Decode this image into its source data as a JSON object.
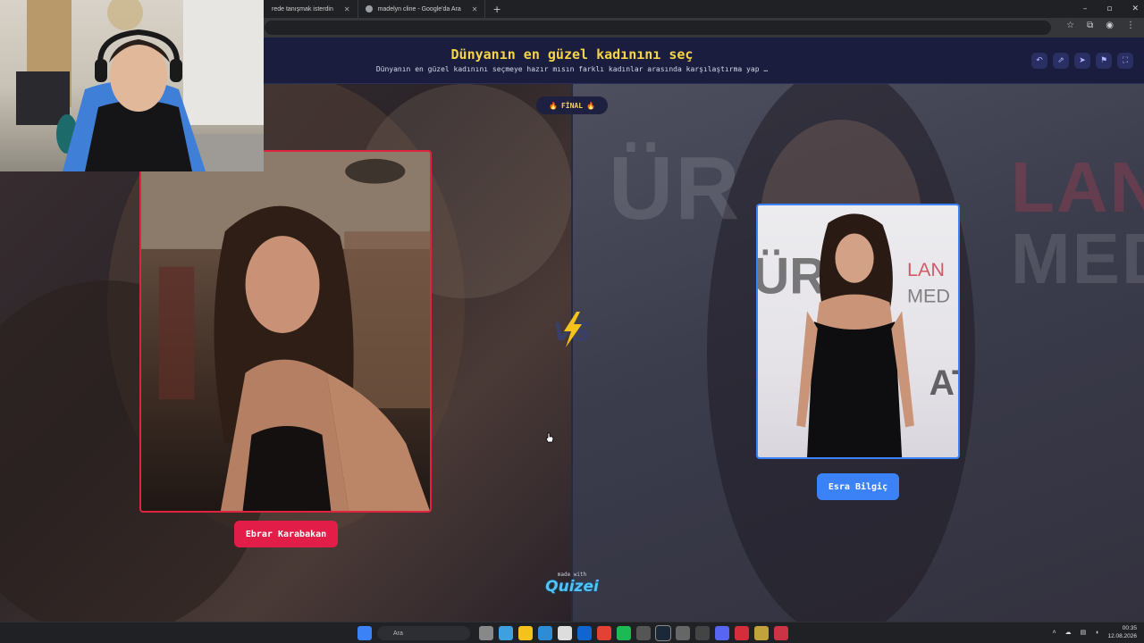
{
  "browser": {
    "tabs": [
      {
        "label": "rede tanışmak isterdin"
      },
      {
        "label": "madelyn cline - Google'da Ara"
      }
    ],
    "new_tab": "+",
    "window_controls": [
      "–",
      "▫",
      "✕"
    ]
  },
  "header": {
    "title": "Dünyanın en güzel kadınını seç",
    "subtitle": "Dünyanın en güzel kadınını seçmeye hazır mısın farklı kadınlar arasında karşılaştırma yap …"
  },
  "round": {
    "label": "FİNAL",
    "emoji": "🔥"
  },
  "contestants": {
    "left": {
      "name": "Ebrar Karabakan",
      "color": "#e11d48"
    },
    "right": {
      "name": "Esra Bilgiç",
      "color": "#3b82f6"
    }
  },
  "vs_label": "VS",
  "footer": {
    "made_with": "made with",
    "brand": "Quizei"
  },
  "taskbar": {
    "search_placeholder": "Ara",
    "time": "00:35",
    "date": "12.08.2026"
  },
  "colors": {
    "title": "#f6d447",
    "left_accent": "#e11d48",
    "right_accent": "#3b82f6"
  }
}
